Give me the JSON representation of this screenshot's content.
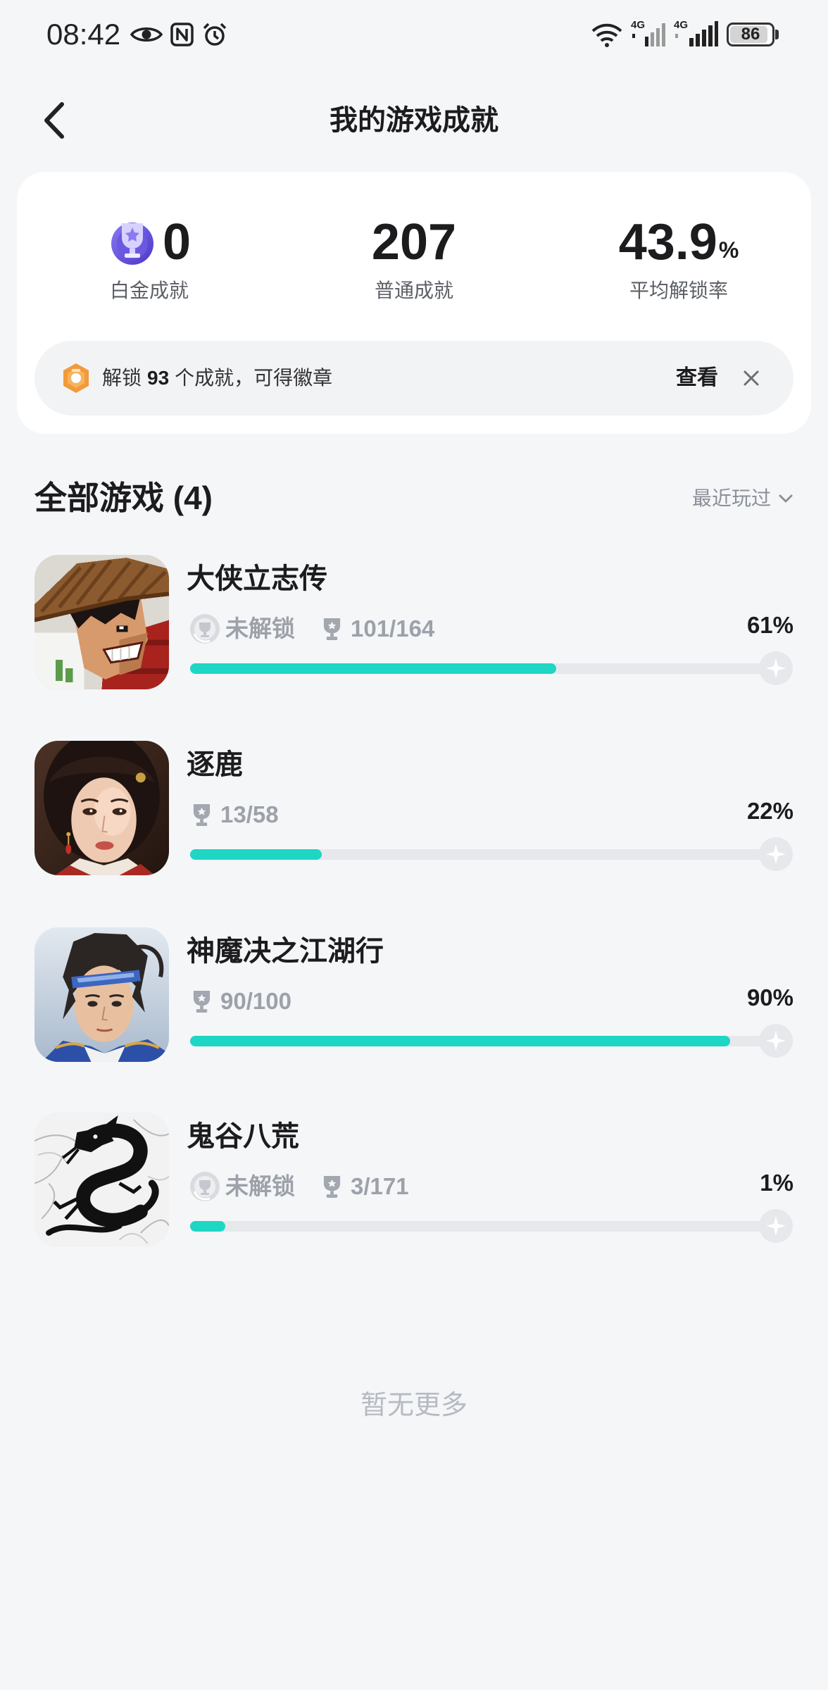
{
  "status_bar": {
    "time": "08:42",
    "network_1": "4G",
    "network_2": "4G",
    "battery": "86",
    "icons": [
      "eye-icon",
      "nfc-icon",
      "alarm-icon",
      "wifi-icon",
      "signal-icon",
      "battery-icon"
    ]
  },
  "header": {
    "title": "我的游戏成就",
    "back_icon": "chevron-left-icon"
  },
  "summary": {
    "platinum": {
      "value": "0",
      "label": "白金成就"
    },
    "normal": {
      "value": "207",
      "label": "普通成就"
    },
    "unlock_rate": {
      "value": "43.9",
      "unit": "%",
      "label": "平均解锁率"
    }
  },
  "badge_banner": {
    "prefix": "解锁",
    "count": "93",
    "suffix": "个成就，可得徽章",
    "action": "查看",
    "close_icon": "close-icon"
  },
  "game_list": {
    "title": "全部游戏 (4)",
    "sort": "最近玩过",
    "sort_icon": "chevron-down-icon"
  },
  "games": [
    {
      "name": "大侠立志传",
      "platinum_status": "未解锁",
      "achievements": "101/164",
      "percent": "61%",
      "progress": 0.61
    },
    {
      "name": "逐鹿",
      "achievements": "13/58",
      "percent": "22%",
      "progress": 0.22
    },
    {
      "name": "神魔决之江湖行",
      "achievements": "90/100",
      "percent": "90%",
      "progress": 0.9
    },
    {
      "name": "鬼谷八荒",
      "platinum_status": "未解锁",
      "achievements": "3/171",
      "percent": "1%",
      "progress": 0.01
    }
  ],
  "footer": {
    "text": "暂无更多"
  },
  "colors": {
    "background": "#f5f6f8",
    "progress_fill": "#1ed6c4",
    "progress_track": "#e6e8ec",
    "muted_text": "#9da1a9",
    "platinum_purple": "#5a46d6",
    "badge_orange": "#f29a3a"
  }
}
